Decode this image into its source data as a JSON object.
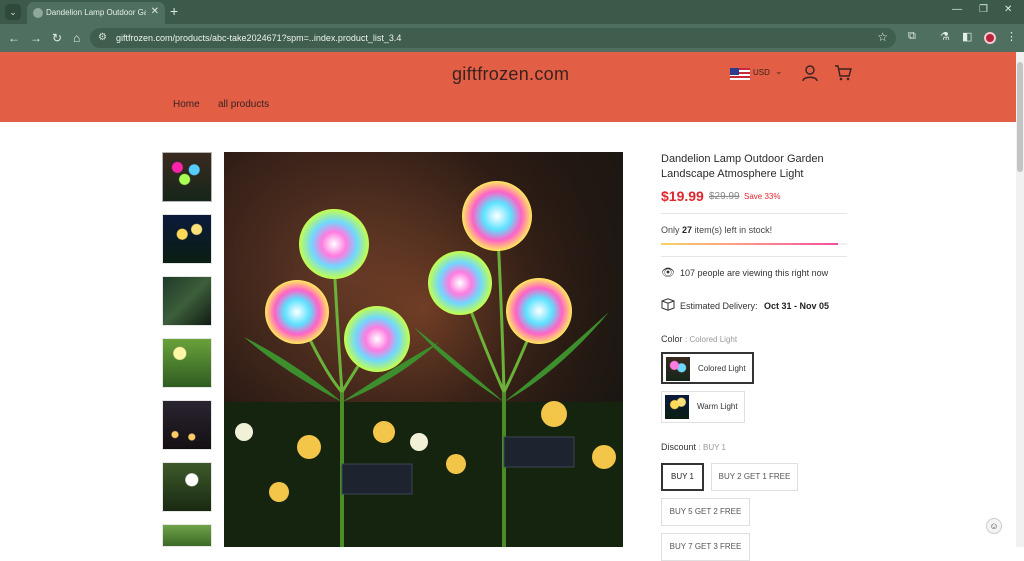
{
  "browser": {
    "tab_title": "Dandelion Lamp Outdoor Garden",
    "tab_close": "✕",
    "new_tab": "+",
    "url": "giftfrozen.com/products/abc-take2024671?spm=..index.product_list_3.4"
  },
  "site": {
    "logo": "giftfrozen.com",
    "currency": "USD",
    "menu": [
      "Home",
      "all products"
    ]
  },
  "product": {
    "title": "Dandelion Lamp Outdoor Garden Landscape Atmosphere Light",
    "price": "$19.99",
    "old_price": "$29.99",
    "save": "Save 33%",
    "stock_prefix": "Only",
    "stock_count": "27",
    "stock_suffix": "item(s) left in stock!",
    "stock_level": 0.95,
    "viewers": "107 people are viewing this right now",
    "delivery_label": "Estimated Delivery:",
    "delivery_dates": "Oct 31 - Nov 05",
    "color_label": "Color",
    "color_selected": "Colored Light",
    "colors": [
      "Colored Light",
      "Warm Light"
    ],
    "discount_label": "Discount",
    "discount_selected": "BUY 1",
    "discounts": [
      "BUY 1",
      "BUY 2 GET 1 FREE",
      "BUY 5 GET 2 FREE",
      "BUY 7 GET 3 FREE"
    ]
  },
  "icons": {
    "eye": "eye-icon",
    "box": "package-icon",
    "user": "user-icon",
    "cart": "cart-icon"
  },
  "colors": {
    "header_bg": "#e25e45",
    "price_red": "#e0262f",
    "browser_green": "#4f7060"
  }
}
